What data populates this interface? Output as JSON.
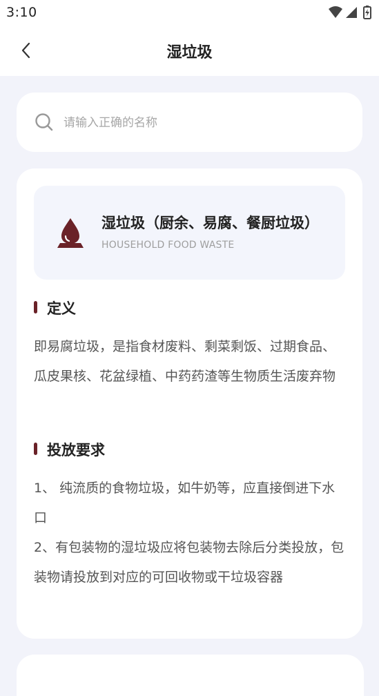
{
  "status_bar": {
    "time": "3:10"
  },
  "header": {
    "title": "湿垃圾"
  },
  "search": {
    "placeholder": "请输入正确的名称",
    "value": ""
  },
  "category": {
    "name": "湿垃圾（厨余、易腐、餐厨垃圾）",
    "name_en": "HOUSEHOLD FOOD WASTE",
    "icon": "water-drop-on-stand-icon",
    "accent_color": "#6a2228"
  },
  "definition": {
    "title": "定义",
    "text": "即易腐垃圾，是指食材废料、剩菜剩饭、过期食品、瓜皮果核、花盆绿植、中药药渣等生物质生活废弃物"
  },
  "requirements": {
    "title": "投放要求",
    "items": [
      "1、 纯流质的食物垃圾，如牛奶等，应直接倒进下水口",
      "2、有包装物的湿垃圾应将包装物去除后分类投放，包装物请投放到对应的可回收物或干垃圾容器"
    ]
  }
}
